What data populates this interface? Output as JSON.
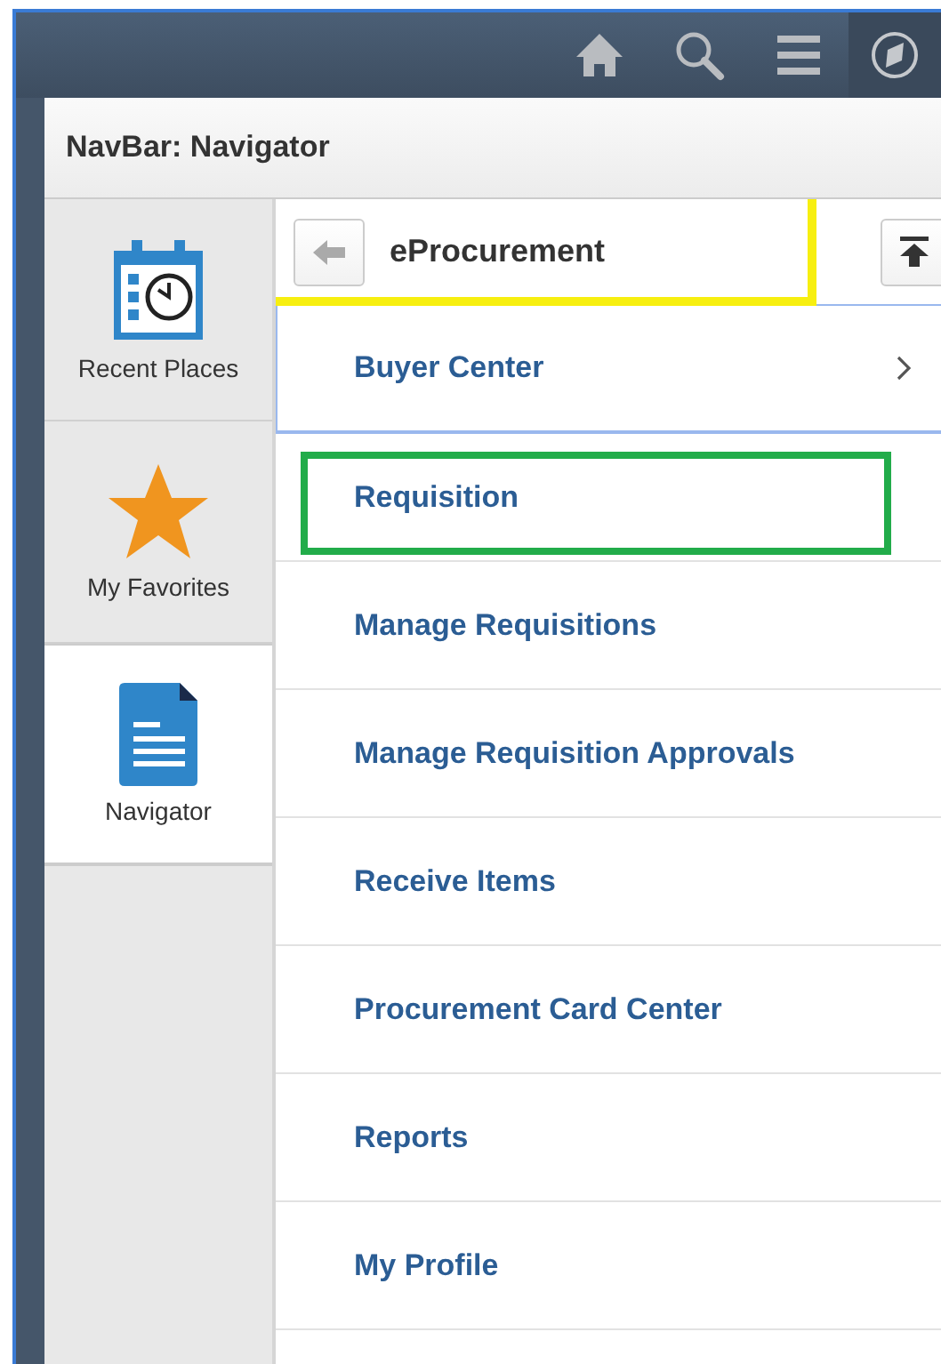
{
  "top_bar": {
    "icons": [
      {
        "kind": "home"
      },
      {
        "kind": "search"
      },
      {
        "kind": "menu"
      },
      {
        "kind": "navbar",
        "selected": true
      }
    ]
  },
  "panel": {
    "title": "NavBar: Navigator"
  },
  "tabs": [
    {
      "kind": "recent",
      "label": "Recent Places",
      "selected": false
    },
    {
      "kind": "favorites",
      "label": "My Favorites",
      "selected": false
    },
    {
      "kind": "navigator",
      "label": "Navigator",
      "selected": true
    }
  ],
  "folder": {
    "title": "eProcurement",
    "highlighted": true
  },
  "items": [
    {
      "label": "Buyer Center",
      "kind": "folder",
      "selected": true,
      "highlighted": false
    },
    {
      "label": "Requisition",
      "kind": "link",
      "selected": false,
      "highlighted": true
    },
    {
      "label": "Manage Requisitions",
      "kind": "link",
      "selected": false,
      "highlighted": false
    },
    {
      "label": "Manage Requisition Approvals",
      "kind": "link",
      "selected": false,
      "highlighted": false
    },
    {
      "label": "Receive Items",
      "kind": "link",
      "selected": false,
      "highlighted": false
    },
    {
      "label": "Procurement Card Center",
      "kind": "link",
      "selected": false,
      "highlighted": false
    },
    {
      "label": "Reports",
      "kind": "link",
      "selected": false,
      "highlighted": false
    },
    {
      "label": "My Profile",
      "kind": "link",
      "selected": false,
      "highlighted": false
    }
  ]
}
